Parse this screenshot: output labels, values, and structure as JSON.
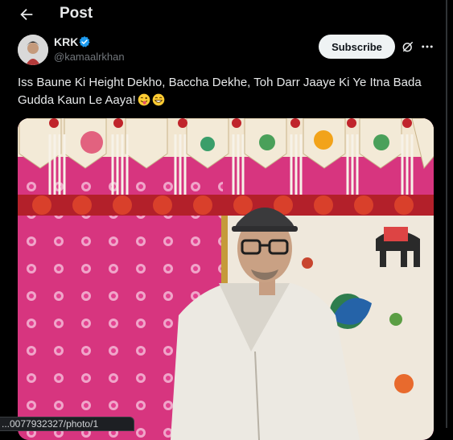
{
  "header": {
    "title": "Post",
    "back_icon": "arrow-left-icon"
  },
  "post": {
    "author_name": "KRK",
    "author_handle": "@kamaalrkhan",
    "verified": true,
    "subscribe_label": "Subscribe",
    "text": "Iss Baune Ki Height Dekho, Baccha Dekhe, Toh Darr Jaaye Ki Ye Itna Bada Gudda Kaun Le Aaya!",
    "emojis": [
      "winking-face-with-tongue",
      "grinning-face"
    ]
  },
  "status_url": "...0077932327/photo/1",
  "colors": {
    "accent": "#1d9bf0",
    "background": "#000000",
    "text": "#e7e9ea",
    "secondary": "#71767b"
  }
}
